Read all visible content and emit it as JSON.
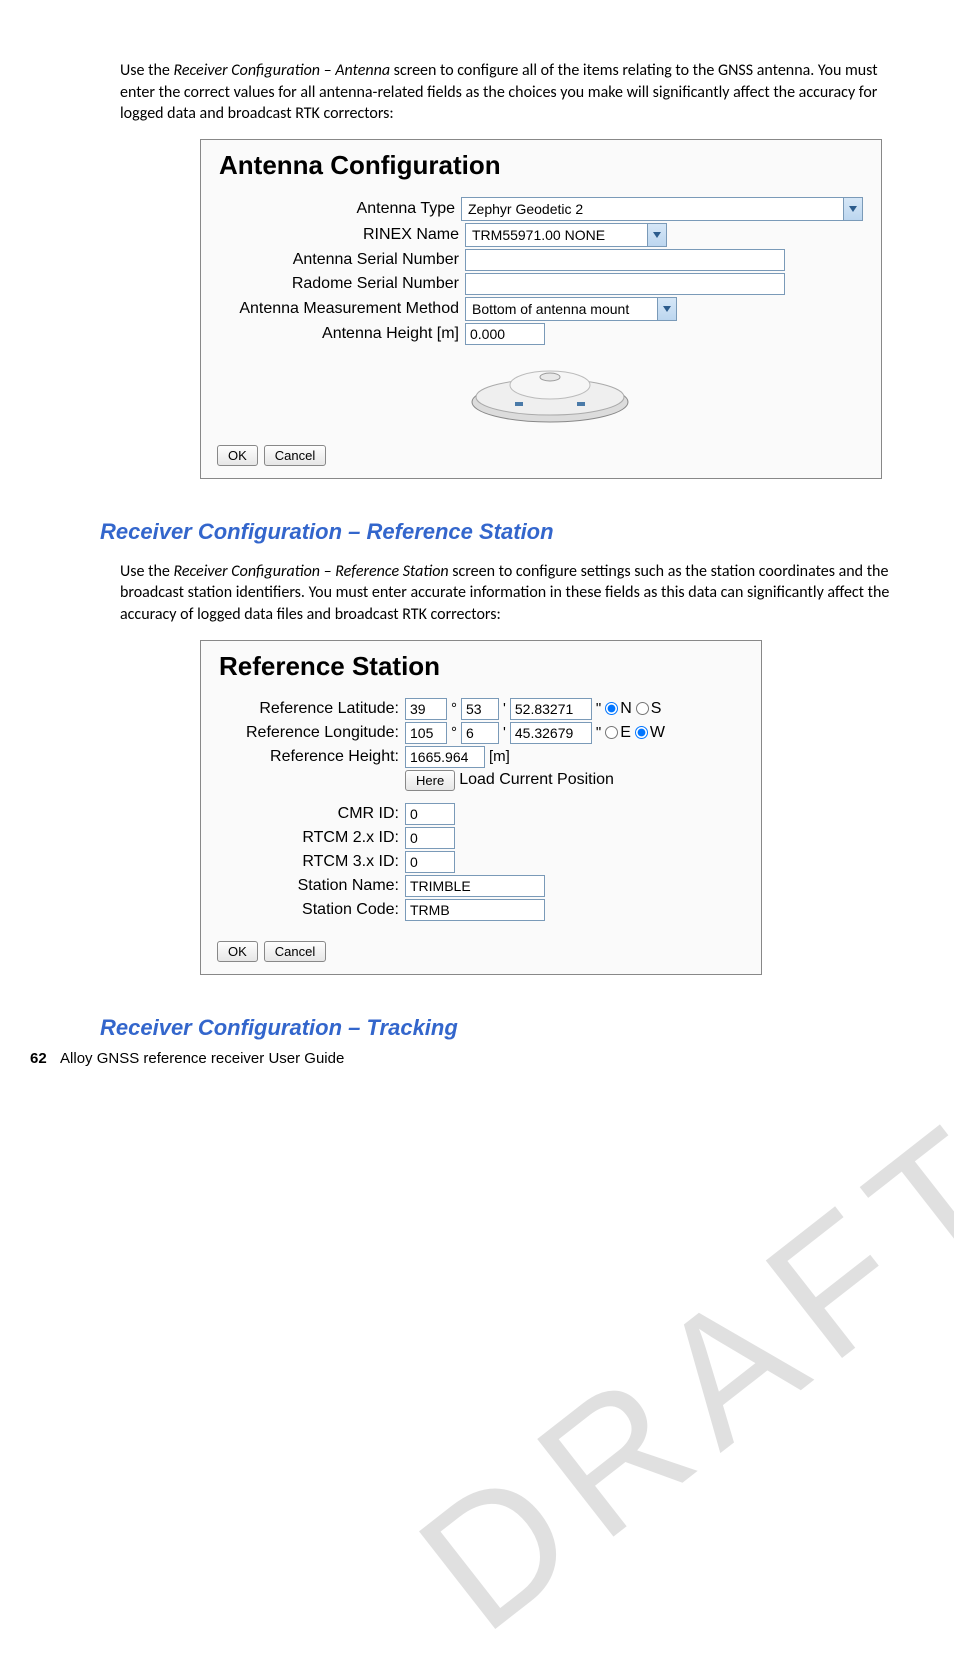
{
  "watermark": "DRAFT - DO NOT DISTRIBUTE",
  "intro1_a": "Use the ",
  "intro1_b": "Receiver Configuration – Antenna",
  "intro1_c": " screen to configure all of the items relating to the GNSS antenna. You must enter the correct values for all antenna-related fields as the choices you make will significantly affect the accuracy for logged data and broadcast RTK correctors:",
  "antenna": {
    "title": "Antenna Configuration",
    "type_label": "Antenna Type",
    "type_value": "Zephyr Geodetic 2",
    "rinex_label": "RINEX Name",
    "rinex_value": "TRM55971.00    NONE",
    "serial_label": "Antenna Serial Number",
    "serial_value": "",
    "radome_label": "Radome Serial Number",
    "radome_value": "",
    "meas_label": "Antenna Measurement Method",
    "meas_value": "Bottom of antenna mount",
    "height_label": "Antenna Height [m]",
    "height_value": "0.000",
    "ok": "OK",
    "cancel": "Cancel"
  },
  "heading_refstation": "Receiver Configuration – Reference Station",
  "intro2_a": "Use the ",
  "intro2_b": "Receiver Configuration – Reference Station",
  "intro2_c": " screen to configure settings such as the station coordinates and the broadcast station identifiers. You must enter accurate information in these fields as this data can significantly affect the accuracy of logged data files and broadcast RTK correctors:",
  "ref": {
    "title": "Reference Station",
    "lat_label": "Reference Latitude:",
    "lat_deg": "39",
    "lat_min": "53",
    "lat_sec": "52.83271",
    "n": "N",
    "s": "S",
    "lon_label": "Reference Longitude:",
    "lon_deg": "105",
    "lon_min": "6",
    "lon_sec": "45.32679",
    "e": "E",
    "w": "W",
    "height_label": "Reference Height:",
    "height_value": "1665.964",
    "height_unit": "[m]",
    "here": "Here",
    "load": "Load Current Position",
    "cmr_label": "CMR ID:",
    "cmr_value": "0",
    "rtcm2_label": "RTCM 2.x ID:",
    "rtcm2_value": "0",
    "rtcm3_label": "RTCM 3.x ID:",
    "rtcm3_value": "0",
    "sname_label": "Station Name:",
    "sname_value": "TRIMBLE",
    "scode_label": "Station Code:",
    "scode_value": "TRMB",
    "ok": "OK",
    "cancel": "Cancel"
  },
  "heading_tracking": "Receiver Configuration – Tracking",
  "footer_page": "62",
  "footer_text": "Alloy GNSS reference receiver User Guide"
}
